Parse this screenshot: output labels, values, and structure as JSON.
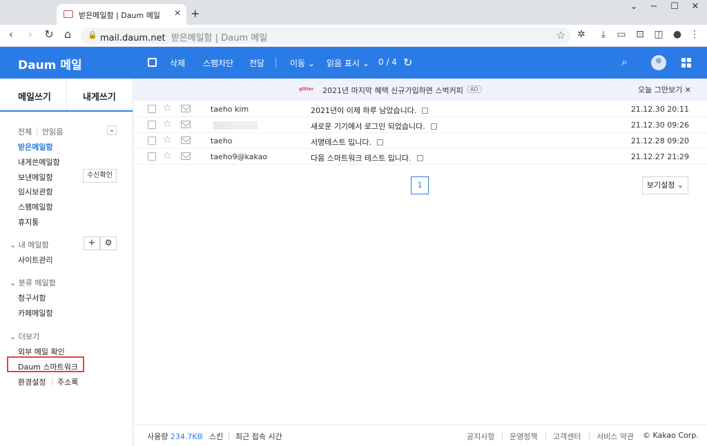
{
  "browser": {
    "tab_title": "받은메일함 | Daum 메일",
    "tab_close": "✕",
    "new_tab": "+",
    "url_domain": "mail.daum.net",
    "url_title": "받은메일함 | Daum 메일",
    "win_min": "−",
    "win_max": "☐",
    "win_close": "✕",
    "win_dropdown": "⌄"
  },
  "header": {
    "logo": "Daum 메일",
    "actions": {
      "delete": "삭제",
      "spam": "스팸차단",
      "forward": "전달",
      "move": "이동",
      "read_mark": "읽음 표시"
    },
    "count": "0 / 4"
  },
  "sidebar": {
    "compose": "메일쓰기",
    "to_me": "내게쓰기",
    "filter_all": "전체",
    "filter_unread": "안읽음",
    "folders": [
      "받은메일함",
      "내게쓴메일함",
      "보낸메일함",
      "임시보관함",
      "스팸메일함",
      "휴지통"
    ],
    "read_confirm": "수신확인",
    "my_mailbox": "내 메일함",
    "site_manage": "사이트관리",
    "categorized": "분류 메일함",
    "bills": "청구서함",
    "cafe": "카페메일함",
    "more": "더보기",
    "external_check": "외부 메일 확인",
    "smartwork": "Daum 스마트워크",
    "settings": "환경설정",
    "address_book": "주소록"
  },
  "ad": {
    "text": "2021년 마지막 혜택 신규가입하면 스벅커피",
    "badge": "AD",
    "close": "오늘 그만보기",
    "logo_text": "glitter"
  },
  "mails": [
    {
      "sender": "taeho kim",
      "subject": "2021년이 이제 하루 남았습니다.",
      "date": "21.12.30 20:11"
    },
    {
      "sender": "",
      "subject": "새로운 기기에서 로그인 되었습니다.",
      "date": "21.12.30 09:26"
    },
    {
      "sender": "taeho",
      "subject": "서명테스트 입니다.",
      "date": "21.12.28 09:20"
    },
    {
      "sender": "taeho9@kakao",
      "subject": "다음 스마트워크 테스트 입니다.",
      "date": "21.12.27 21:29"
    }
  ],
  "pagination": {
    "current": "1"
  },
  "view_settings": "보기설정",
  "footer": {
    "usage_label": "사용량",
    "usage_value": "234.7KB",
    "skin": "스킨",
    "recent_login": "최근 접속 시간",
    "notice": "공지사항",
    "policy": "운영정책",
    "support": "고객센터",
    "terms": "서비스 약관",
    "copyright": "© Kakao Corp."
  },
  "colors": {
    "accent": "#2b7be6",
    "highlight_box": "#e8403c"
  },
  "icons": [
    "search-icon",
    "user-avatar-icon",
    "apps-grid-icon",
    "refresh-icon",
    "star-icon",
    "envelope-icon",
    "plus-icon",
    "gear-icon"
  ]
}
